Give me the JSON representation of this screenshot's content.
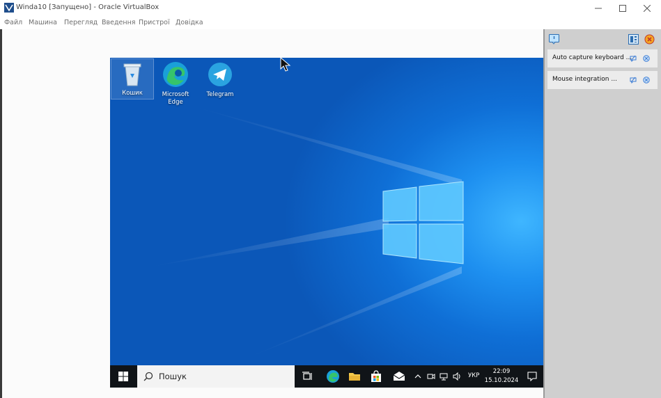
{
  "window": {
    "title": "Winda10 [Запущено] - Oracle VirtualBox",
    "minimize_icon": "minimize-icon",
    "maximize_icon": "maximize-icon",
    "close_icon": "close-icon"
  },
  "menu": {
    "items": [
      "Файл",
      "Машина",
      "Перегляд",
      "Введення",
      "Пристрої",
      "Довідка"
    ]
  },
  "desktop": {
    "icons": [
      {
        "label": "Кошик",
        "icon": "recycle-bin-icon"
      },
      {
        "label": "Microsoft Edge",
        "icon": "edge-icon"
      },
      {
        "label": "Telegram",
        "icon": "telegram-icon"
      }
    ],
    "accent": "#1e90f0"
  },
  "taskbar": {
    "search_label": "Пошук",
    "language": "УКР",
    "time": "22:09",
    "date": "15.10.2024",
    "pinned": [
      "task-view-icon",
      "edge-icon",
      "file-explorer-icon",
      "store-icon",
      "mail-icon"
    ],
    "tray": [
      "chevron-up-icon",
      "meet-now-icon",
      "network-icon",
      "volume-icon"
    ]
  },
  "notifications": {
    "items": [
      {
        "text": "Auto capture keyboard ..."
      },
      {
        "text": "Mouse integration ..."
      }
    ]
  }
}
